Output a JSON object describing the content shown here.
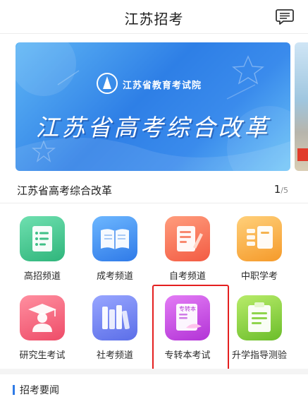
{
  "header": {
    "title": "江苏招考",
    "message_icon": "message-icon"
  },
  "banner": {
    "logo_text": "江苏省教育考试院",
    "headline": "江苏省高考综合改革",
    "caption": "江苏省高考综合改革",
    "current_page": "1",
    "total_pages": "/5"
  },
  "grid": [
    {
      "label": "高招频道",
      "icon": "document-list-icon",
      "color": "#41c58e"
    },
    {
      "label": "成考频道",
      "icon": "open-book-icon",
      "color": "#3f8cf0"
    },
    {
      "label": "自考频道",
      "icon": "pen-paper-icon",
      "color": "#f86b4f"
    },
    {
      "label": "中职学考",
      "icon": "stacked-books-icon",
      "color": "#f8a93a"
    },
    {
      "label": "研究生考试",
      "icon": "graduate-icon",
      "color": "#f05a74"
    },
    {
      "label": "社考频道",
      "icon": "bookshelf-icon",
      "color": "#6b7ef2"
    },
    {
      "label": "专转本考试",
      "icon": "magazine-icon",
      "color": "#c545e0",
      "book_text": "专转本"
    },
    {
      "label": "升学指导测验",
      "icon": "clipboard-icon",
      "color": "#86cf3e"
    }
  ],
  "news": {
    "title": "招考要闻"
  }
}
